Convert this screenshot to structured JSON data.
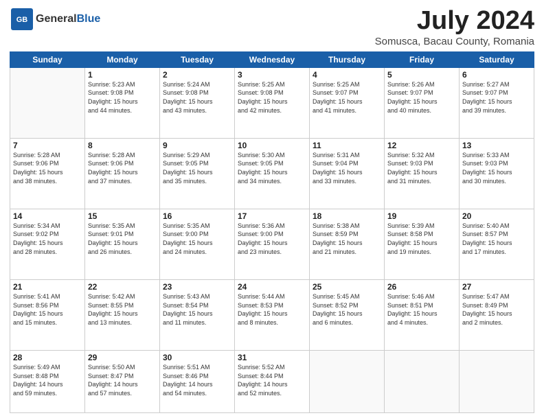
{
  "header": {
    "logo_general": "General",
    "logo_blue": "Blue",
    "month_title": "July 2024",
    "location": "Somusca, Bacau County, Romania"
  },
  "weekdays": [
    "Sunday",
    "Monday",
    "Tuesday",
    "Wednesday",
    "Thursday",
    "Friday",
    "Saturday"
  ],
  "weeks": [
    [
      {
        "day": "",
        "info": ""
      },
      {
        "day": "1",
        "info": "Sunrise: 5:23 AM\nSunset: 9:08 PM\nDaylight: 15 hours\nand 44 minutes."
      },
      {
        "day": "2",
        "info": "Sunrise: 5:24 AM\nSunset: 9:08 PM\nDaylight: 15 hours\nand 43 minutes."
      },
      {
        "day": "3",
        "info": "Sunrise: 5:25 AM\nSunset: 9:08 PM\nDaylight: 15 hours\nand 42 minutes."
      },
      {
        "day": "4",
        "info": "Sunrise: 5:25 AM\nSunset: 9:07 PM\nDaylight: 15 hours\nand 41 minutes."
      },
      {
        "day": "5",
        "info": "Sunrise: 5:26 AM\nSunset: 9:07 PM\nDaylight: 15 hours\nand 40 minutes."
      },
      {
        "day": "6",
        "info": "Sunrise: 5:27 AM\nSunset: 9:07 PM\nDaylight: 15 hours\nand 39 minutes."
      }
    ],
    [
      {
        "day": "7",
        "info": "Sunrise: 5:28 AM\nSunset: 9:06 PM\nDaylight: 15 hours\nand 38 minutes."
      },
      {
        "day": "8",
        "info": "Sunrise: 5:28 AM\nSunset: 9:06 PM\nDaylight: 15 hours\nand 37 minutes."
      },
      {
        "day": "9",
        "info": "Sunrise: 5:29 AM\nSunset: 9:05 PM\nDaylight: 15 hours\nand 35 minutes."
      },
      {
        "day": "10",
        "info": "Sunrise: 5:30 AM\nSunset: 9:05 PM\nDaylight: 15 hours\nand 34 minutes."
      },
      {
        "day": "11",
        "info": "Sunrise: 5:31 AM\nSunset: 9:04 PM\nDaylight: 15 hours\nand 33 minutes."
      },
      {
        "day": "12",
        "info": "Sunrise: 5:32 AM\nSunset: 9:03 PM\nDaylight: 15 hours\nand 31 minutes."
      },
      {
        "day": "13",
        "info": "Sunrise: 5:33 AM\nSunset: 9:03 PM\nDaylight: 15 hours\nand 30 minutes."
      }
    ],
    [
      {
        "day": "14",
        "info": "Sunrise: 5:34 AM\nSunset: 9:02 PM\nDaylight: 15 hours\nand 28 minutes."
      },
      {
        "day": "15",
        "info": "Sunrise: 5:35 AM\nSunset: 9:01 PM\nDaylight: 15 hours\nand 26 minutes."
      },
      {
        "day": "16",
        "info": "Sunrise: 5:35 AM\nSunset: 9:00 PM\nDaylight: 15 hours\nand 24 minutes."
      },
      {
        "day": "17",
        "info": "Sunrise: 5:36 AM\nSunset: 9:00 PM\nDaylight: 15 hours\nand 23 minutes."
      },
      {
        "day": "18",
        "info": "Sunrise: 5:38 AM\nSunset: 8:59 PM\nDaylight: 15 hours\nand 21 minutes."
      },
      {
        "day": "19",
        "info": "Sunrise: 5:39 AM\nSunset: 8:58 PM\nDaylight: 15 hours\nand 19 minutes."
      },
      {
        "day": "20",
        "info": "Sunrise: 5:40 AM\nSunset: 8:57 PM\nDaylight: 15 hours\nand 17 minutes."
      }
    ],
    [
      {
        "day": "21",
        "info": "Sunrise: 5:41 AM\nSunset: 8:56 PM\nDaylight: 15 hours\nand 15 minutes."
      },
      {
        "day": "22",
        "info": "Sunrise: 5:42 AM\nSunset: 8:55 PM\nDaylight: 15 hours\nand 13 minutes."
      },
      {
        "day": "23",
        "info": "Sunrise: 5:43 AM\nSunset: 8:54 PM\nDaylight: 15 hours\nand 11 minutes."
      },
      {
        "day": "24",
        "info": "Sunrise: 5:44 AM\nSunset: 8:53 PM\nDaylight: 15 hours\nand 8 minutes."
      },
      {
        "day": "25",
        "info": "Sunrise: 5:45 AM\nSunset: 8:52 PM\nDaylight: 15 hours\nand 6 minutes."
      },
      {
        "day": "26",
        "info": "Sunrise: 5:46 AM\nSunset: 8:51 PM\nDaylight: 15 hours\nand 4 minutes."
      },
      {
        "day": "27",
        "info": "Sunrise: 5:47 AM\nSunset: 8:49 PM\nDaylight: 15 hours\nand 2 minutes."
      }
    ],
    [
      {
        "day": "28",
        "info": "Sunrise: 5:49 AM\nSunset: 8:48 PM\nDaylight: 14 hours\nand 59 minutes."
      },
      {
        "day": "29",
        "info": "Sunrise: 5:50 AM\nSunset: 8:47 PM\nDaylight: 14 hours\nand 57 minutes."
      },
      {
        "day": "30",
        "info": "Sunrise: 5:51 AM\nSunset: 8:46 PM\nDaylight: 14 hours\nand 54 minutes."
      },
      {
        "day": "31",
        "info": "Sunrise: 5:52 AM\nSunset: 8:44 PM\nDaylight: 14 hours\nand 52 minutes."
      },
      {
        "day": "",
        "info": ""
      },
      {
        "day": "",
        "info": ""
      },
      {
        "day": "",
        "info": ""
      }
    ]
  ]
}
